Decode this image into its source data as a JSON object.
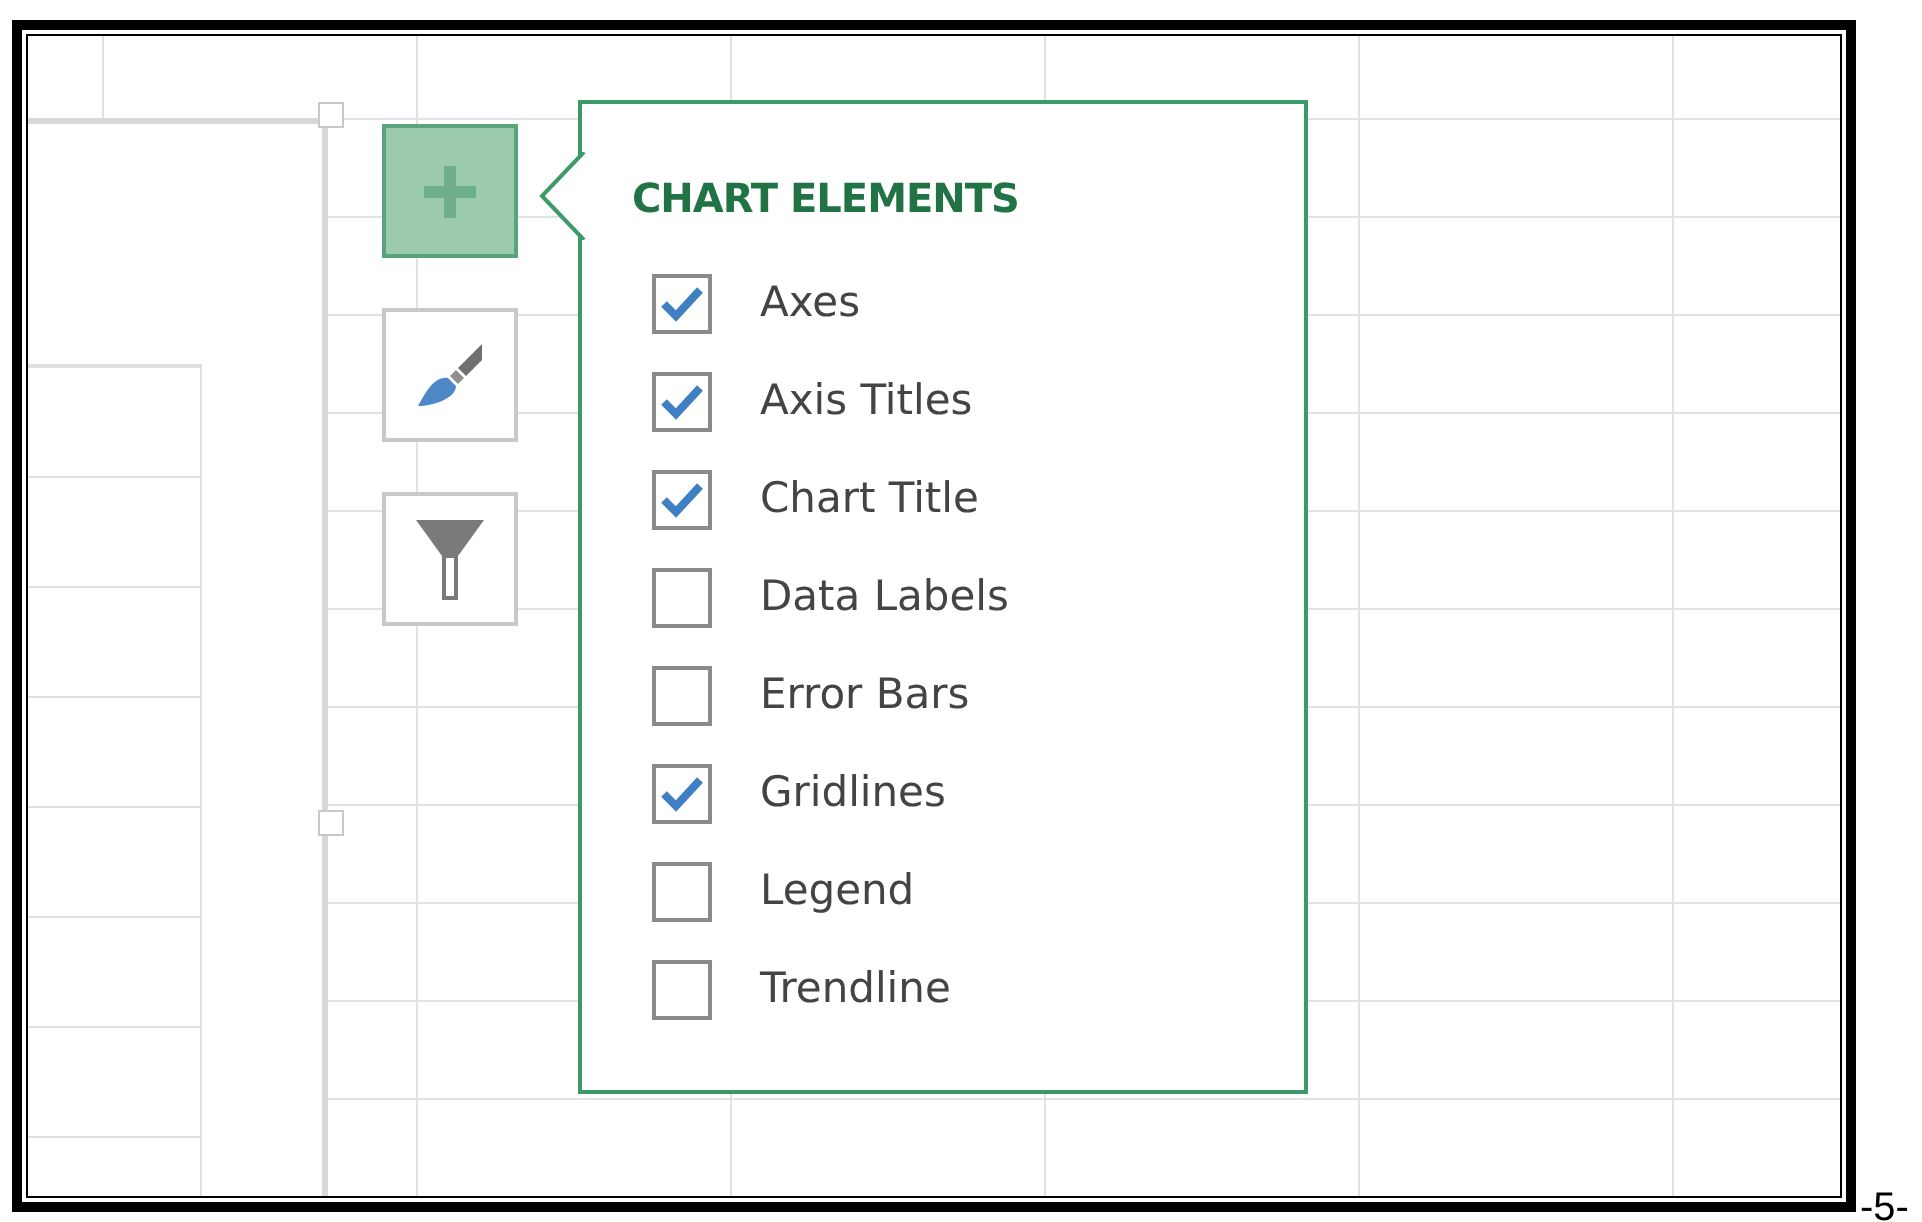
{
  "side_buttons": [
    {
      "kind": "add",
      "selected": true
    },
    {
      "kind": "style",
      "selected": false
    },
    {
      "kind": "filter",
      "selected": false
    }
  ],
  "flyout": {
    "title": "CHART ELEMENTS",
    "items": [
      {
        "label": "Axes",
        "checked": true
      },
      {
        "label": "Axis Titles",
        "checked": true
      },
      {
        "label": "Chart Title",
        "checked": true
      },
      {
        "label": "Data Labels",
        "checked": false
      },
      {
        "label": "Error Bars",
        "checked": false
      },
      {
        "label": "Gridlines",
        "checked": true
      },
      {
        "label": "Legend",
        "checked": false
      },
      {
        "label": "Trendline",
        "checked": false
      }
    ]
  },
  "page_number": "-5-"
}
